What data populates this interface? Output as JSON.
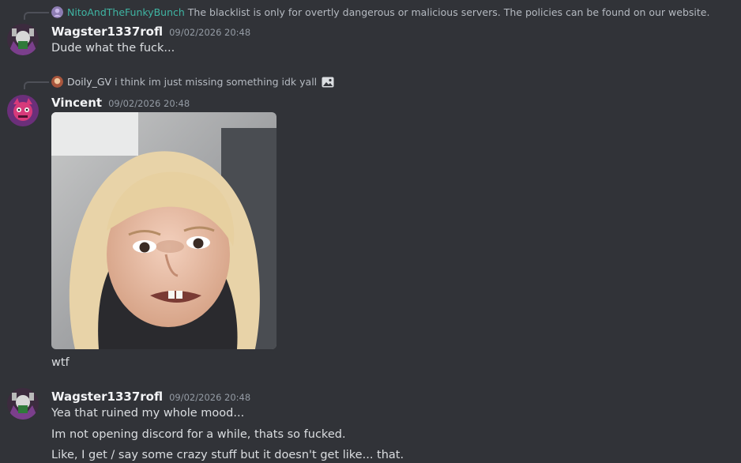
{
  "messages": [
    {
      "reply": {
        "author": "NitoAndTheFunkyBunch",
        "author_color": "#3fb5a3",
        "text": "The blacklist is only for overtly dangerous or malicious servers. The policies can be found on our website."
      },
      "author": "Wagster1337rofl",
      "timestamp": "09/02/2026 20:48",
      "lines": [
        "Dude what the fuck..."
      ]
    },
    {
      "reply": {
        "author": "Doily_GV",
        "author_color": "#c9cdd3",
        "text": "i think im just missing something idk yall",
        "icon": "image-icon"
      },
      "author": "Vincent",
      "timestamp": "09/02/2026 20:48",
      "attachment": "meme-image",
      "lines": [
        "wtf"
      ]
    },
    {
      "author": "Wagster1337rofl",
      "timestamp": "09/02/2026 20:48",
      "lines": [
        "Yea that ruined my whole mood...",
        "Im not opening discord for a while, thats so fucked.",
        "Like, I get / say some crazy stuff but it doesn't get like... that."
      ]
    }
  ]
}
